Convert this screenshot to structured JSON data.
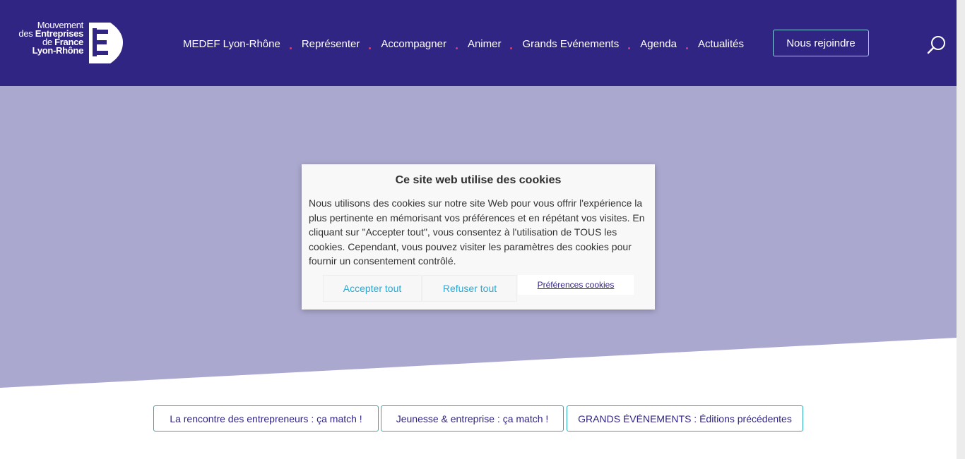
{
  "logo": {
    "line1": "Mouvement",
    "line2a": "des ",
    "line2b": "Entreprises",
    "line3a": "de ",
    "line3b": "France",
    "line4": "Lyon-Rhône"
  },
  "nav": {
    "items": [
      {
        "label": "MEDEF Lyon-Rhône"
      },
      {
        "label": "Représenter"
      },
      {
        "label": "Accompagner"
      },
      {
        "label": "Animer"
      },
      {
        "label": "Grands Evénements"
      },
      {
        "label": "Agenda"
      },
      {
        "label": "Actualités"
      }
    ],
    "join_label": "Nous rejoindre",
    "search_icon": "search-icon"
  },
  "cookie_banner": {
    "title": "Ce site web utilise des cookies",
    "text": "Nous utilisons des cookies sur notre site Web pour vous offrir l'expérience la plus pertinente en mémorisant vos préférences et en répétant vos visites. En cliquant sur \"Accepter tout\", vous consentez à l'utilisation de TOUS les cookies. Cependant, vous pouvez visiter les paramètres des cookies pour fournir un consentement contrôlé.",
    "accept_label": "Accepter tout",
    "refuse_label": "Refuser tout",
    "prefs_label": "Préférences cookies"
  },
  "tags": [
    {
      "label": "La rencontre des entrepreneurs : ça match !"
    },
    {
      "label": "Jeunesse & entreprise : ça match !"
    },
    {
      "label": "GRANDS ÉVÉNEMENTS : Éditions précédentes"
    }
  ],
  "colors": {
    "header_bg": "#302582",
    "hero_bg": "#aba8cf",
    "accent": "#28aad6",
    "nav_dot": "#e03b6e"
  }
}
